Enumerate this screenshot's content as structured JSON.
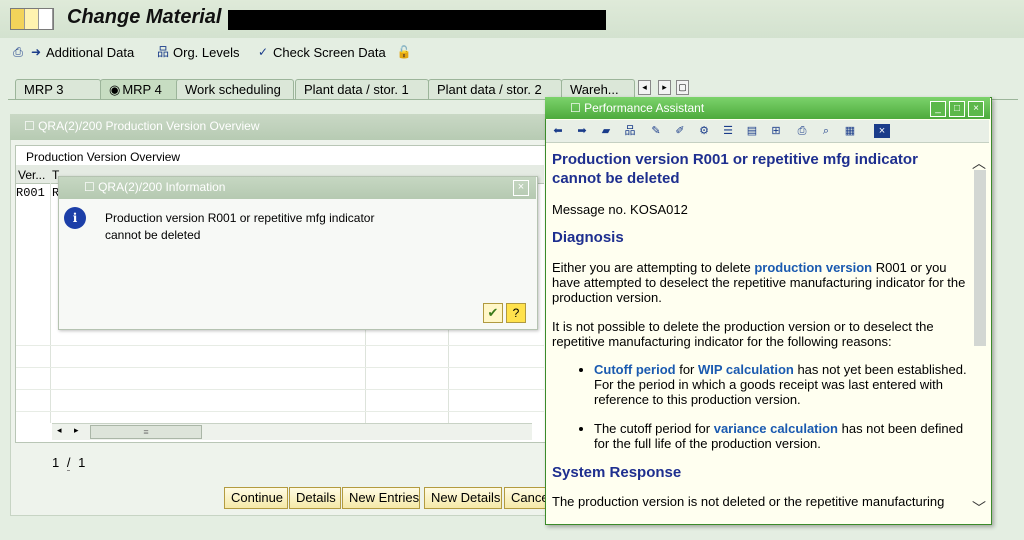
{
  "window": {
    "title": "Change Material"
  },
  "toolbar": {
    "additional_data": "Additional Data",
    "org_levels": "Org. Levels",
    "check_screen_data": "Check Screen Data"
  },
  "tabs": [
    {
      "label": "MRP 3"
    },
    {
      "label": "MRP 4"
    },
    {
      "label": "Work scheduling"
    },
    {
      "label": "Plant data / stor. 1"
    },
    {
      "label": "Plant data / stor. 2"
    },
    {
      "label": "Wareh..."
    }
  ],
  "overview": {
    "title": "QRA(2)/200 Production Version Overview",
    "table_title": "Production Version Overview",
    "columns": [
      "Ver...",
      "T"
    ],
    "rows": [
      {
        "version": "R001",
        "text": "R"
      }
    ],
    "pager": {
      "current": "1",
      "sep": "/",
      "total": "1"
    },
    "buttons": {
      "continue": "Continue",
      "details": "Details",
      "new_entries": "New Entries",
      "new_details": "New Details",
      "cancel": "Cance"
    }
  },
  "info_dialog": {
    "title": "QRA(2)/200 Information",
    "message": "Production version R001 or repetitive mfg indicator cannot be deleted",
    "close": "×"
  },
  "assistant": {
    "title": "Performance Assistant",
    "heading": "Production version R001 or repetitive mfg indicator cannot be deleted",
    "message_no": "Message no. KOSA012",
    "diagnosis_heading": "Diagnosis",
    "diag1": {
      "t1": "Either you are attempting to delete ",
      "l1": "production version",
      "t2": " R001 or you have attempted to deselect the repetitive manufacturing indicator for the production version."
    },
    "diag2": "It is not possible to delete the production version or to deselect the repetitive manufacturing indicator for the following reasons:",
    "bullet1": {
      "l1": "Cutoff period",
      "t1": " for ",
      "l2": "WIP calculation",
      "t2": " has not yet been established. For the period in which a goods receipt was last entered with reference to this production version."
    },
    "bullet2": {
      "t1": "The cutoff period for ",
      "l1": "variance calculation",
      "t2": " has not been defined for the full life of the production version."
    },
    "response_heading": "System Response",
    "response_text": "The production version is not deleted or the repetitive manufacturing"
  }
}
